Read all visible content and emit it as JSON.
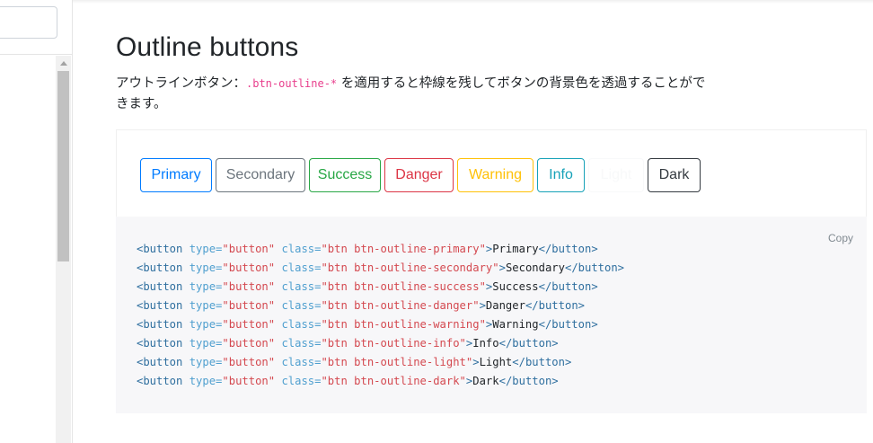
{
  "page": {
    "title": "Outline buttons",
    "lead_before": "アウトラインボタン：",
    "lead_code": ".btn-outline-*",
    "lead_after": " を適用すると枠線を残してボタンの背景色を透過することができます。"
  },
  "buttons": [
    {
      "label": "Primary",
      "color": "#007bff",
      "width": 80
    },
    {
      "label": "Secondary",
      "color": "#6c757d",
      "width": 100
    },
    {
      "label": "Success",
      "color": "#28a745",
      "width": 80
    },
    {
      "label": "Danger",
      "color": "#dc3545",
      "width": 77
    },
    {
      "label": "Warning",
      "color": "#ffc107",
      "width": 85
    },
    {
      "label": "Info",
      "color": "#17a2b8",
      "width": 53
    },
    {
      "label": "Light",
      "color": "#f8f9fa",
      "width": 62
    },
    {
      "label": "Dark",
      "color": "#343a40",
      "width": 59
    }
  ],
  "code": {
    "copy_label": "Copy",
    "lines": [
      {
        "cls": "btn btn-outline-primary",
        "text": "Primary"
      },
      {
        "cls": "btn btn-outline-secondary",
        "text": "Secondary"
      },
      {
        "cls": "btn btn-outline-success",
        "text": "Success"
      },
      {
        "cls": "btn btn-outline-danger",
        "text": "Danger"
      },
      {
        "cls": "btn btn-outline-warning",
        "text": "Warning"
      },
      {
        "cls": "btn btn-outline-info",
        "text": "Info"
      },
      {
        "cls": "btn btn-outline-light",
        "text": "Light"
      },
      {
        "cls": "btn btn-outline-dark",
        "text": "Dark"
      }
    ]
  }
}
